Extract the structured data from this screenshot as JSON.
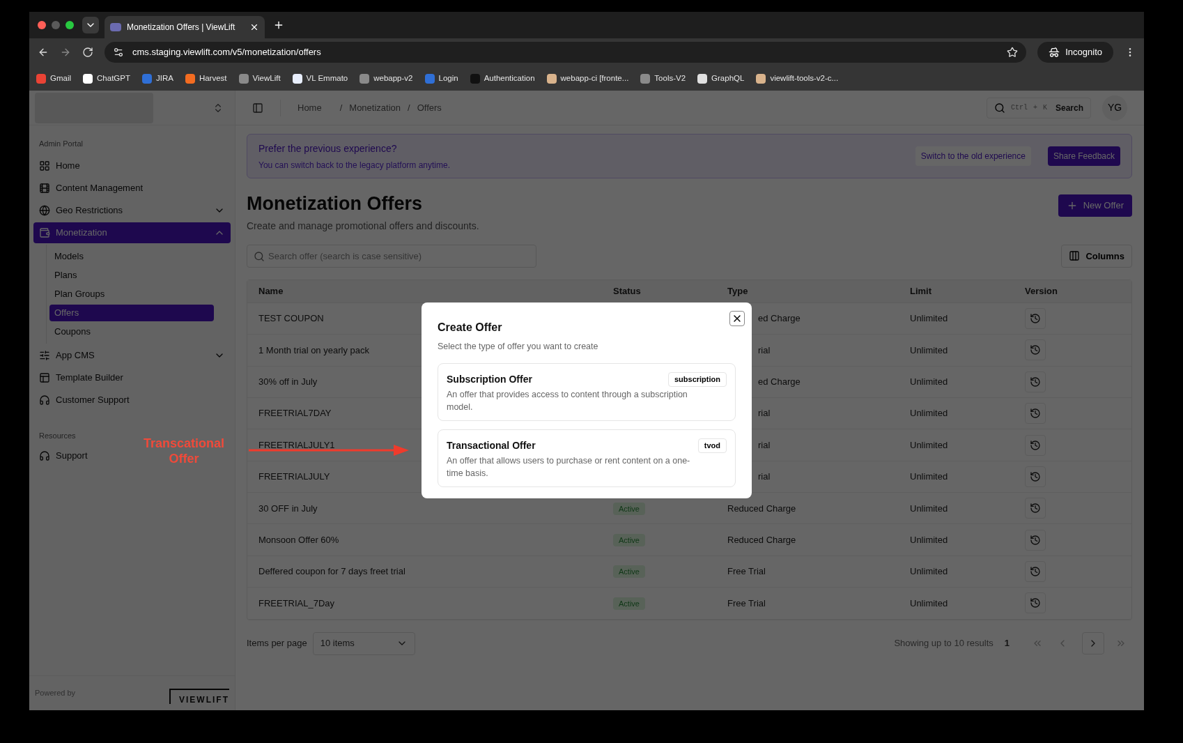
{
  "browser": {
    "tab_title": "Monetization Offers | ViewLift",
    "url": "cms.staging.viewlift.com/v5/monetization/offers",
    "profile": "Incognito",
    "bookmarks": [
      {
        "label": "Gmail",
        "color": "#ea4335"
      },
      {
        "label": "ChatGPT",
        "color": "#ffffff"
      },
      {
        "label": "JIRA",
        "color": "#2f6fd6"
      },
      {
        "label": "Harvest",
        "color": "#f36c21"
      },
      {
        "label": "ViewLift",
        "color": "#8a8a8a"
      },
      {
        "label": "VL Emmato",
        "color": "#e8eefc"
      },
      {
        "label": "webapp-v2",
        "color": "#8a8a8a"
      },
      {
        "label": "Login",
        "color": "#2f6fd6"
      },
      {
        "label": "Authentication",
        "color": "#111111"
      },
      {
        "label": "webapp-ci [fronte...",
        "color": "#d9b38c"
      },
      {
        "label": "Tools-V2",
        "color": "#8a8a8a"
      },
      {
        "label": "GraphQL",
        "color": "#e0e0e0"
      },
      {
        "label": "viewlift-tools-v2-c...",
        "color": "#d9b38c"
      }
    ]
  },
  "sidebar": {
    "section": "Admin Portal",
    "items": [
      {
        "label": "Home",
        "kind": "link",
        "selected": false
      },
      {
        "label": "Content Management",
        "kind": "link",
        "selected": false
      },
      {
        "label": "Geo Restrictions",
        "kind": "group",
        "expanded": false,
        "selected": false
      },
      {
        "label": "Monetization",
        "kind": "group",
        "expanded": true,
        "selected": true,
        "children": [
          {
            "label": "Models",
            "selected": false
          },
          {
            "label": "Plans",
            "selected": false
          },
          {
            "label": "Plan Groups",
            "selected": false
          },
          {
            "label": "Offers",
            "selected": true
          },
          {
            "label": "Coupons",
            "selected": false
          }
        ]
      },
      {
        "label": "App CMS",
        "kind": "group",
        "expanded": false,
        "selected": false
      },
      {
        "label": "Template Builder",
        "kind": "link",
        "selected": false
      },
      {
        "label": "Customer Support",
        "kind": "link",
        "selected": false
      }
    ],
    "resources_section": "Resources",
    "resources": [
      {
        "label": "Support"
      }
    ],
    "footer": {
      "powered_by": "Powered by",
      "logo": "VIEWLIFT"
    }
  },
  "header": {
    "breadcrumbs": [
      "Home",
      "Monetization",
      "Offers"
    ],
    "separator": "/",
    "search": {
      "keys": [
        "Ctrl",
        "+",
        "K"
      ],
      "label": "Search"
    },
    "avatar": "YG"
  },
  "banner": {
    "title": "Prefer the previous experience?",
    "text": "You can switch back to the legacy platform anytime.",
    "buttons": [
      "Switch to the old experience",
      "Share Feedback"
    ]
  },
  "page": {
    "title": "Monetization Offers",
    "subtitle": "Create and manage promotional offers and discounts.",
    "new_button": "New Offer",
    "search_placeholder": "Search offer (search is case sensitive)",
    "columns_button": "Columns"
  },
  "table": {
    "columns": [
      "Name",
      "Status",
      "Type",
      "Limit",
      "Version"
    ],
    "rows": [
      {
        "name": "TEST COUPON",
        "type": "ed Charge",
        "limit": "Unlimited"
      },
      {
        "name": "1 Month trial on yearly pack",
        "type": "rial",
        "limit": "Unlimited"
      },
      {
        "name": "30% off in July",
        "type": "ed Charge",
        "limit": "Unlimited"
      },
      {
        "name": "FREETRIAL7DAY",
        "type": "rial",
        "limit": "Unlimited"
      },
      {
        "name": "FREETRIALJULY1",
        "type": "rial",
        "limit": "Unlimited"
      },
      {
        "name": "FREETRIALJULY",
        "type": "rial",
        "limit": "Unlimited"
      },
      {
        "name": "30 OFF in July",
        "status": "Active",
        "type": "Reduced Charge",
        "limit": "Unlimited"
      },
      {
        "name": "Monsoon Offer 60%",
        "status": "Active",
        "type": "Reduced Charge",
        "limit": "Unlimited"
      },
      {
        "name": "Deffered coupon for 7 days freet trial",
        "status": "Active",
        "type": "Free Trial",
        "limit": "Unlimited"
      },
      {
        "name": "FREETRIAL_7Day",
        "status": "Active",
        "type": "Free Trial",
        "limit": "Unlimited"
      }
    ]
  },
  "pagination": {
    "label": "Items per page",
    "per_page": "10 items",
    "summary": "Showing up to 10 results",
    "page": "1"
  },
  "modal": {
    "title": "Create Offer",
    "subtitle": "Select the type of offer you want to create",
    "options": [
      {
        "title": "Subscription Offer",
        "tag": "subscription",
        "description": "An offer that provides access to content through a subscription model."
      },
      {
        "title": "Transactional Offer",
        "tag": "tvod",
        "description": "An offer that allows users to purchase or rent content on a one-time basis."
      }
    ]
  },
  "annotation": {
    "text": "Transcational Offer"
  }
}
